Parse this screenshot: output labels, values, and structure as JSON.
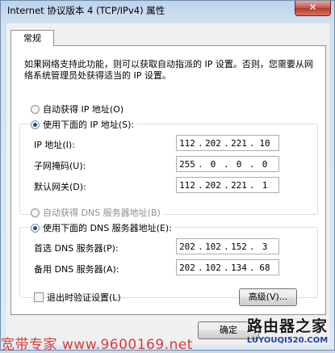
{
  "window": {
    "title": "Internet 协议版本 4 (TCP/IPv4) 属性",
    "close_glyph": "✕"
  },
  "tabs": [
    {
      "label": "常规"
    }
  ],
  "description": "如果网络支持此功能，则可以获取自动指派的 IP 设置。否则，您需要从网络系统管理员处获得适当的 IP 设置。",
  "ip_section": {
    "auto_label": "自动获得 IP 地址(O)",
    "manual_label": "使用下面的 IP 地址(S):",
    "selected": "manual",
    "fields": [
      {
        "label": "IP 地址(I):",
        "octets": [
          "112",
          "202",
          "221",
          "10"
        ]
      },
      {
        "label": "子网掩码(U):",
        "octets": [
          "255",
          "0",
          "0",
          "0"
        ]
      },
      {
        "label": "默认网关(D):",
        "octets": [
          "112",
          "202",
          "221",
          "1"
        ]
      }
    ]
  },
  "dns_section": {
    "auto_label": "自动获得 DNS 服务器地址(B)",
    "manual_label": "使用下面的 DNS 服务器地址(E):",
    "selected": "manual",
    "fields": [
      {
        "label": "首选 DNS 服务器(P):",
        "octets": [
          "202",
          "102",
          "152",
          "3"
        ]
      },
      {
        "label": "备用 DNS 服务器(A):",
        "octets": [
          "202",
          "102",
          "134",
          "68"
        ]
      }
    ]
  },
  "validate_checkbox": {
    "label": "退出时验证设置(L)",
    "checked": false
  },
  "buttons": {
    "advanced": "高级(V)...",
    "ok": "确定"
  },
  "watermarks": {
    "left": "宽带专家 www.9600169.net",
    "right_top": "路由器之家",
    "right_bottom": "LUYOUQI520.COM"
  },
  "colors": {
    "radio_dot": "#1c4e8c",
    "close_button": "#c75050",
    "watermark_red": "#d91c1c"
  }
}
